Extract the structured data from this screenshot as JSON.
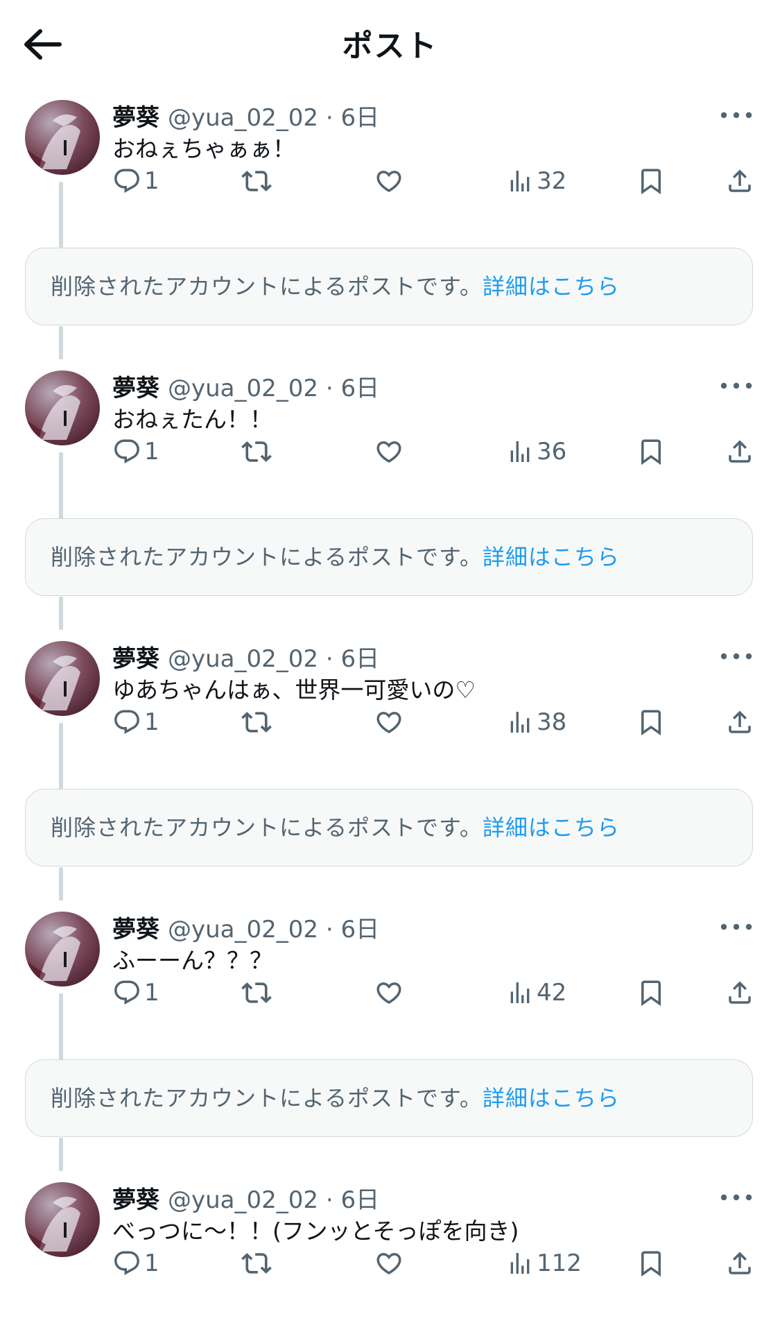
{
  "header": {
    "title": "ポスト",
    "back_icon": "arrow-left-icon"
  },
  "tweets": [
    {
      "name": "夢葵",
      "handle": "@yua_02_02",
      "time": "6日",
      "text": "おねぇちゃぁぁ！",
      "replies": "1",
      "views": "32"
    },
    {
      "name": "夢葵",
      "handle": "@yua_02_02",
      "time": "6日",
      "text": "おねぇたん！！",
      "replies": "1",
      "views": "36"
    },
    {
      "name": "夢葵",
      "handle": "@yua_02_02",
      "time": "6日",
      "text": "ゆあちゃんはぁ、世界一可愛いの♡",
      "replies": "1",
      "views": "38"
    },
    {
      "name": "夢葵",
      "handle": "@yua_02_02",
      "time": "6日",
      "text": "ふーーん？？？",
      "replies": "1",
      "views": "42"
    },
    {
      "name": "夢葵",
      "handle": "@yua_02_02",
      "time": "6日",
      "text": "べっつに〜！！(フンッとそっぽを向き)",
      "replies": "1",
      "views": "112"
    }
  ],
  "deleted_notice": {
    "message": "削除されたアカウントによるポストです。",
    "link": "詳細はこちら"
  },
  "colors": {
    "accent": "#1d9bf0",
    "muted": "#536471",
    "border": "#cfd9de",
    "text": "#0f1419"
  },
  "icons": [
    "reply-icon",
    "retweet-icon",
    "like-icon",
    "views-icon",
    "bookmark-icon",
    "share-icon",
    "more-icon"
  ]
}
